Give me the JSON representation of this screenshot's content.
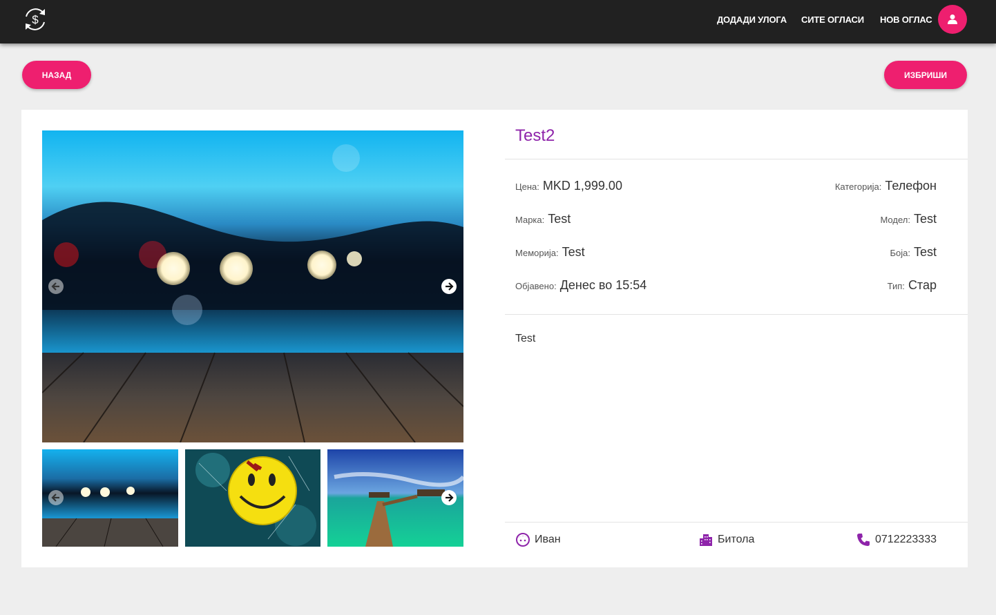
{
  "nav": {
    "links": [
      "ДОДАДИ УЛОГА",
      "СИТЕ ОГЛАСИ",
      "НОВ ОГЛАС"
    ],
    "logo_icon": "dollar-sync-icon",
    "user_icon": "user-icon"
  },
  "actions": {
    "back_label": "НАЗАД",
    "delete_label": "ИЗБРИШИ"
  },
  "listing": {
    "title": "Test2",
    "fields": {
      "price_label": "Цена:",
      "price_value": "MKD 1,999.00",
      "category_label": "Категорија:",
      "category_value": "Телефон",
      "brand_label": "Марка:",
      "brand_value": "Test",
      "model_label": "Модел:",
      "model_value": "Test",
      "memory_label": "Меморија:",
      "memory_value": "Test",
      "color_label": "Боја:",
      "color_value": "Test",
      "published_label": "Објавено:",
      "published_value": "Денес во 15:54",
      "type_label": "Тип:",
      "type_value": "Стар"
    },
    "description": "Test",
    "owner": "Иван",
    "city": "Битола",
    "phone": "0712223333"
  },
  "gallery": {
    "images": [
      "bokeh-pier",
      "smiley-badge",
      "tropical-boardwalk"
    ]
  },
  "colors": {
    "accent": "#ee1f6f",
    "title": "#8e24aa",
    "navbar": "#212121",
    "background": "#eeeeee"
  }
}
